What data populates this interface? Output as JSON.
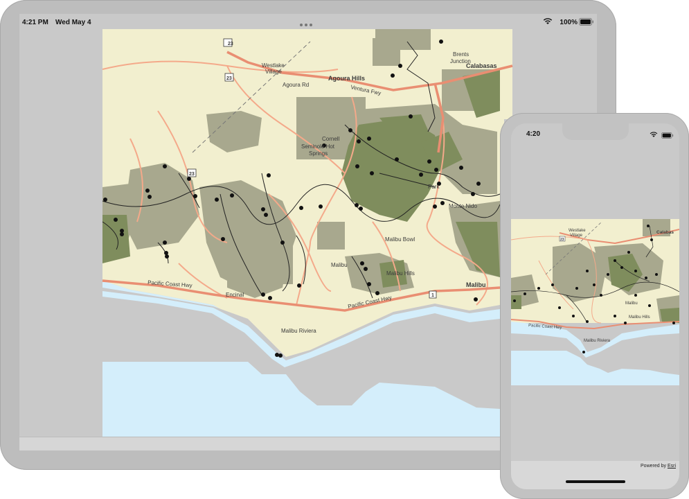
{
  "tablet": {
    "status_bar": {
      "time": "4:21 PM",
      "date": "Wed May 4",
      "battery": "100%"
    },
    "map": {
      "labels": {
        "westlake": "Westlake",
        "village": "Village",
        "agoura_rd": "Agoura Rd",
        "agoura_hills": "Agoura Hills",
        "ventura_fwy": "Ventura Fwy",
        "brents": "Brents",
        "junction": "Junction",
        "calabasas": "Calabasas",
        "cornell": "Cornell",
        "seminole_hot": "Seminole Hot",
        "springs": "Springs",
        "monte_nido": "Monte Nido",
        "malibu_bowl": "Malibu Bowl",
        "malibu": "Malibu",
        "malibu_hills": "Malibu Hills",
        "malibu_east": "Malibu",
        "pacific_coast_hwy": "Pacific Coast Hwy",
        "pacific_coast_hwy_2": "Pacific Coast Hwy",
        "encinal": "Encinal",
        "latigo_park": "Park",
        "malibu_riviera": "Malibu Riviera",
        "shield_23a": "23",
        "shield_23b": "23",
        "shield_23c": "23",
        "shield_1": "1"
      }
    }
  },
  "phone": {
    "status_bar": {
      "time": "4:20"
    },
    "map": {
      "labels": {
        "westlake": "Westlake",
        "village": "Village",
        "calabasas": "Calabas",
        "shield_23": "23",
        "malibu": "Malibu",
        "malibu_hills": "Malibu Hills",
        "pacific_coast_hwy": "Pacific Coast Hwy",
        "malibu_riviera": "Malibu Riviera"
      }
    },
    "attribution": {
      "prefix": "Powered by",
      "link": "Esri"
    }
  },
  "colors": {
    "land": "#f2efcf",
    "land_alt": "#e8e4c0",
    "public_land": "#a8a88e",
    "park": "#7f8d5d",
    "water": "#d4eefb",
    "road": "#f4a98a",
    "road_major": "#e98e72",
    "trail": "#222222"
  }
}
